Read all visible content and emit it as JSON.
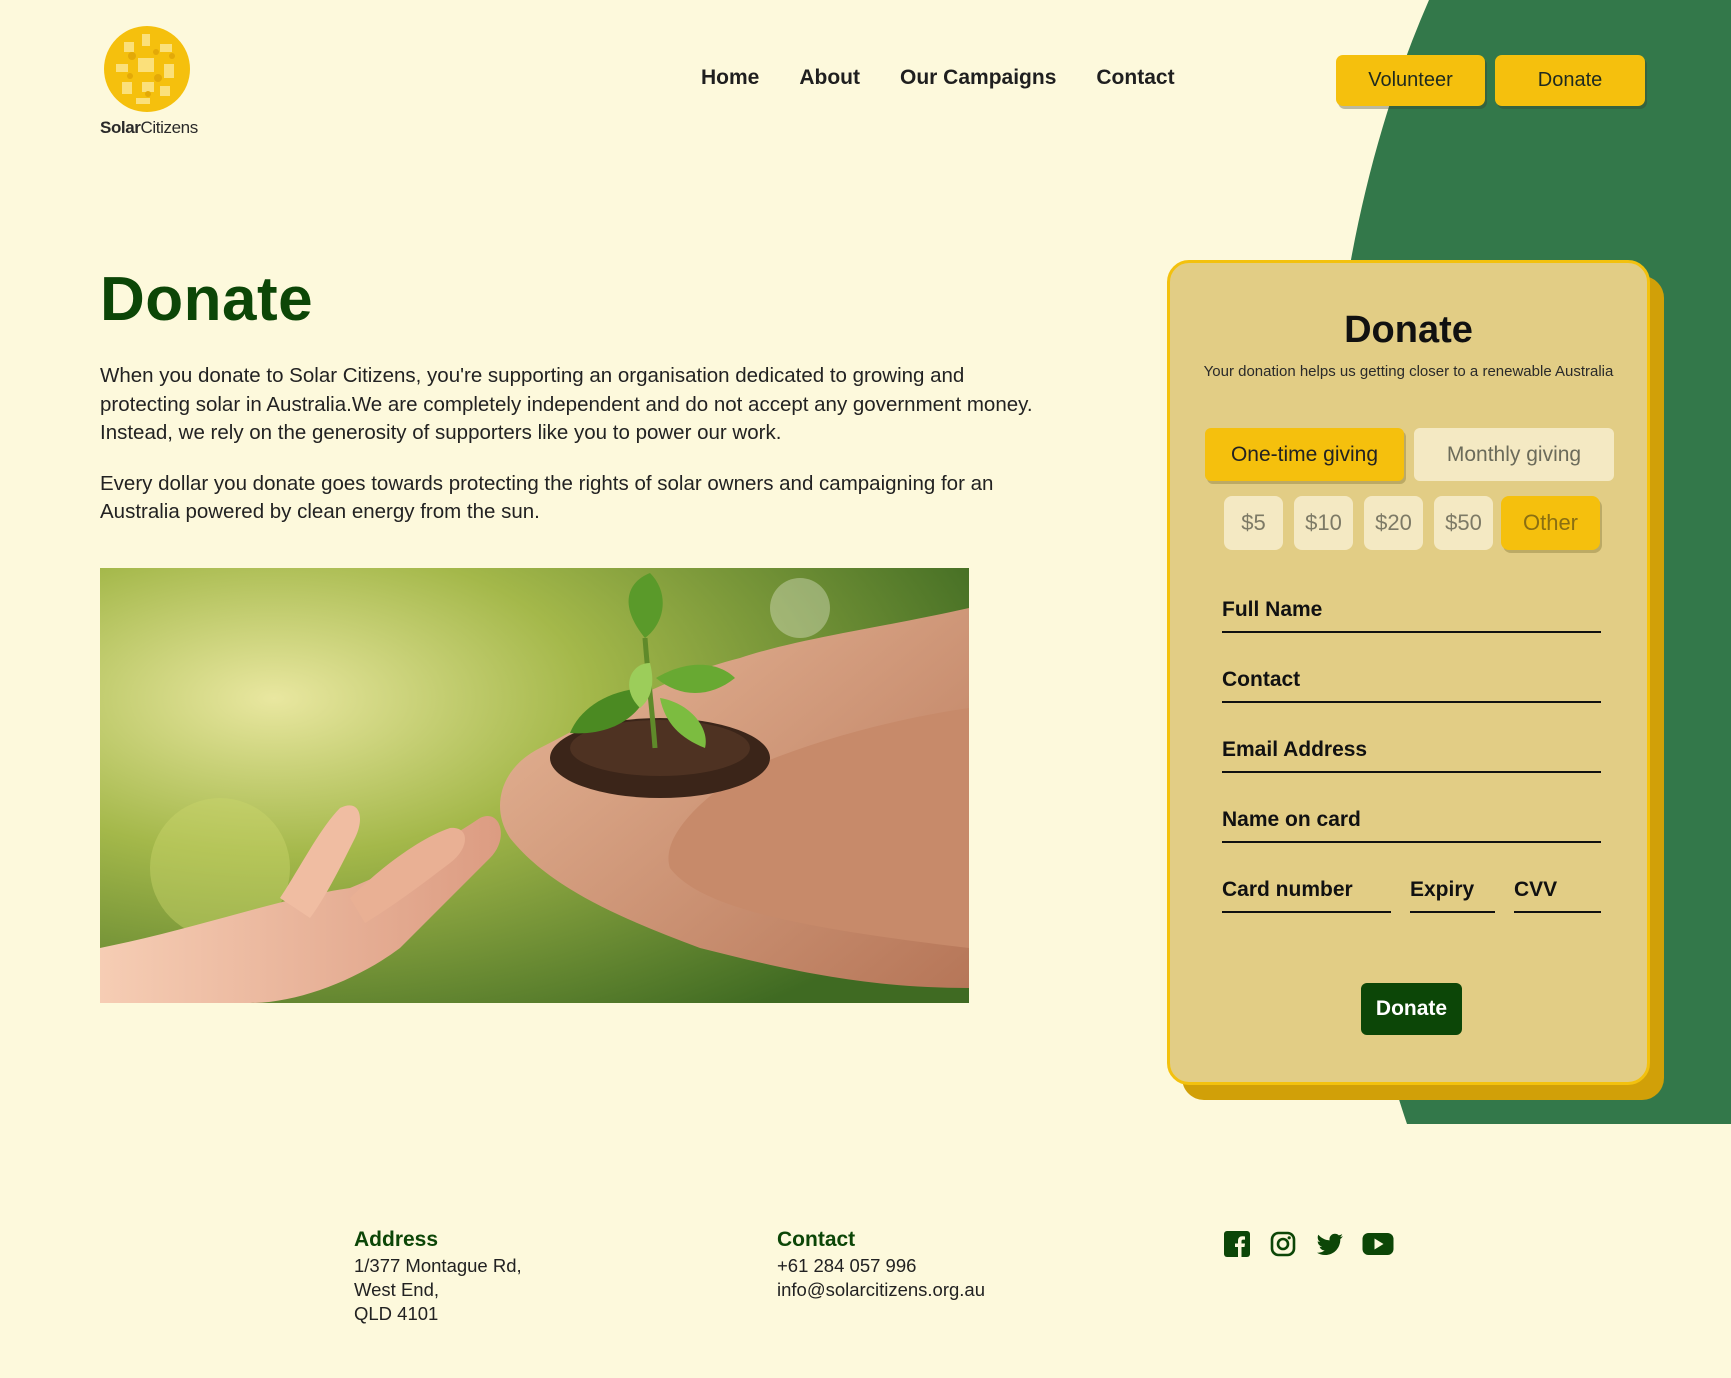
{
  "brand": {
    "name_bold": "Solar",
    "name_regular": "Citizens",
    "accent": "#f5c00d",
    "dark_green": "#0c4607",
    "bg_green": "#33784a",
    "background": "#fdf9dc"
  },
  "nav": {
    "items": [
      "Home",
      "About",
      "Our Campaigns",
      "Contact"
    ]
  },
  "header": {
    "volunteer_label": "Volunteer",
    "donate_label": "Donate"
  },
  "main": {
    "title": "Donate",
    "paragraphs": [
      "When you donate to Solar Citizens, you're supporting an organisation dedicated to growing and protecting solar in Australia.We are completely independent and do not accept any government money. Instead, we rely on the generosity of supporters like you to power our work.",
      "Every dollar you donate goes towards protecting the rights of solar owners and campaigning for an Australia powered by clean energy from the sun."
    ]
  },
  "form": {
    "title": "Donate",
    "subtitle": "Your donation helps us getting closer to a renewable Australia",
    "frequency": {
      "one_time": "One-time giving",
      "monthly": "Monthly giving",
      "selected": "One-time giving"
    },
    "amounts": [
      "$5",
      "$10",
      "$20",
      "$50",
      "Other"
    ],
    "selected_amount": "Other",
    "fields": {
      "full_name": "Full Name",
      "contact": "Contact",
      "email": "Email Address",
      "name_on_card": "Name on card",
      "card_number": "Card number",
      "expiry": "Expiry",
      "cvv": "CVV"
    },
    "submit_label": "Donate"
  },
  "footer": {
    "address_heading": "Address",
    "address_lines": [
      "1/377 Montague Rd,",
      "West End,",
      "QLD 4101"
    ],
    "contact_heading": "Contact",
    "phone": "+61 284 057 996",
    "email": "info@solarcitizens.org.au",
    "socials": [
      "facebook-icon",
      "instagram-icon",
      "twitter-icon",
      "youtube-icon"
    ]
  }
}
